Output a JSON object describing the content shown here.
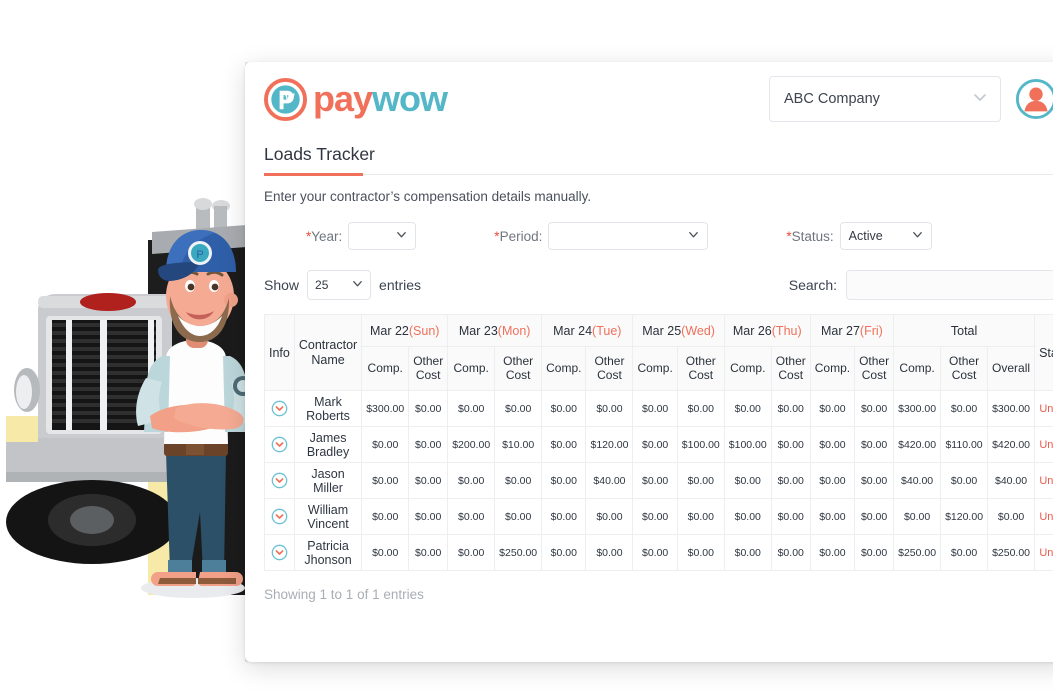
{
  "brand": {
    "logo_pay": "pay",
    "logo_wow": "wow",
    "logo_mark_name": "paywow-logo-mark",
    "accent_orange": "#f0705a",
    "accent_teal": "#54b7c8",
    "status_red": "#f0584a"
  },
  "topbar": {
    "company_value": "ABC Company",
    "company_caret": "⌄",
    "avatar_name": "user-avatar"
  },
  "page": {
    "title": "Loads Tracker",
    "subtitle": "Enter your contractor’s compensation details manually."
  },
  "filters": {
    "year": {
      "label": "Year:",
      "required": "*",
      "value": "",
      "caret": "⌄"
    },
    "period": {
      "label": "Period:",
      "required": "*",
      "value": "",
      "caret": "⌄"
    },
    "status": {
      "label": "Status:",
      "required": "*",
      "value": "Active",
      "caret": "⌄"
    }
  },
  "table_controls": {
    "show_label": "Show",
    "show_value": "25",
    "entries_label": "entries",
    "show_caret": "⌄",
    "search_label": "Search:",
    "search_value": "",
    "search_placeholder": ""
  },
  "table": {
    "col_info": "Info",
    "col_contractor": "Contractor Name",
    "col_total": "Total",
    "col_status": "Status",
    "sub_comp": "Comp.",
    "sub_other": "Other Cost",
    "sub_overall": "Overall",
    "days": [
      {
        "date": "Mar 22",
        "dow": "(Sun)"
      },
      {
        "date": "Mar 23",
        "dow": "(Mon)"
      },
      {
        "date": "Mar 24",
        "dow": "(Tue)"
      },
      {
        "date": "Mar 25",
        "dow": "(Wed)"
      },
      {
        "date": "Mar 26",
        "dow": "(Thu)"
      },
      {
        "date": "Mar 27",
        "dow": "(Fri)"
      }
    ],
    "rows": [
      {
        "name": "Mark Roberts",
        "cells": [
          "$300.00",
          "$0.00",
          "$0.00",
          "$0.00",
          "$0.00",
          "$0.00",
          "$0.00",
          "$0.00",
          "$0.00",
          "$0.00",
          "$0.00",
          "$0.00"
        ],
        "total_comp": "$300.00",
        "total_other": "$0.00",
        "total_overall": "$300.00",
        "status": "Unpaid"
      },
      {
        "name": "James Bradley",
        "cells": [
          "$0.00",
          "$0.00",
          "$200.00",
          "$10.00",
          "$0.00",
          "$120.00",
          "$0.00",
          "$100.00",
          "$100.00",
          "$0.00",
          "$0.00",
          "$0.00"
        ],
        "total_comp": "$420.00",
        "total_other": "$110.00",
        "total_overall": "$420.00",
        "status": "Unpaid"
      },
      {
        "name": "Jason Miller",
        "cells": [
          "$0.00",
          "$0.00",
          "$0.00",
          "$0.00",
          "$0.00",
          "$40.00",
          "$0.00",
          "$0.00",
          "$0.00",
          "$0.00",
          "$0.00",
          "$0.00"
        ],
        "total_comp": "$40.00",
        "total_other": "$0.00",
        "total_overall": "$40.00",
        "status": "Unpaid"
      },
      {
        "name": "William Vincent",
        "cells": [
          "$0.00",
          "$0.00",
          "$0.00",
          "$0.00",
          "$0.00",
          "$0.00",
          "$0.00",
          "$0.00",
          "$0.00",
          "$0.00",
          "$0.00",
          "$0.00"
        ],
        "total_comp": "$0.00",
        "total_other": "$120.00",
        "total_overall": "$0.00",
        "status": "Unpaid"
      },
      {
        "name": "Patricia Jhonson",
        "cells": [
          "$0.00",
          "$0.00",
          "$0.00",
          "$250.00",
          "$0.00",
          "$0.00",
          "$0.00",
          "$0.00",
          "$0.00",
          "$0.00",
          "$0.00",
          "$0.00"
        ],
        "total_comp": "$250.00",
        "total_other": "$0.00",
        "total_overall": "$250.00",
        "status": "Unpaid"
      }
    ],
    "expand_icon_name": "expand-row-chevron-icon"
  },
  "footer": {
    "entries_info": "Showing 1 to 1 of 1 entries"
  },
  "illustration": {
    "name": "truck-driver-illustration",
    "alt": "Cartoon truck driver standing in front of a semi truck"
  }
}
